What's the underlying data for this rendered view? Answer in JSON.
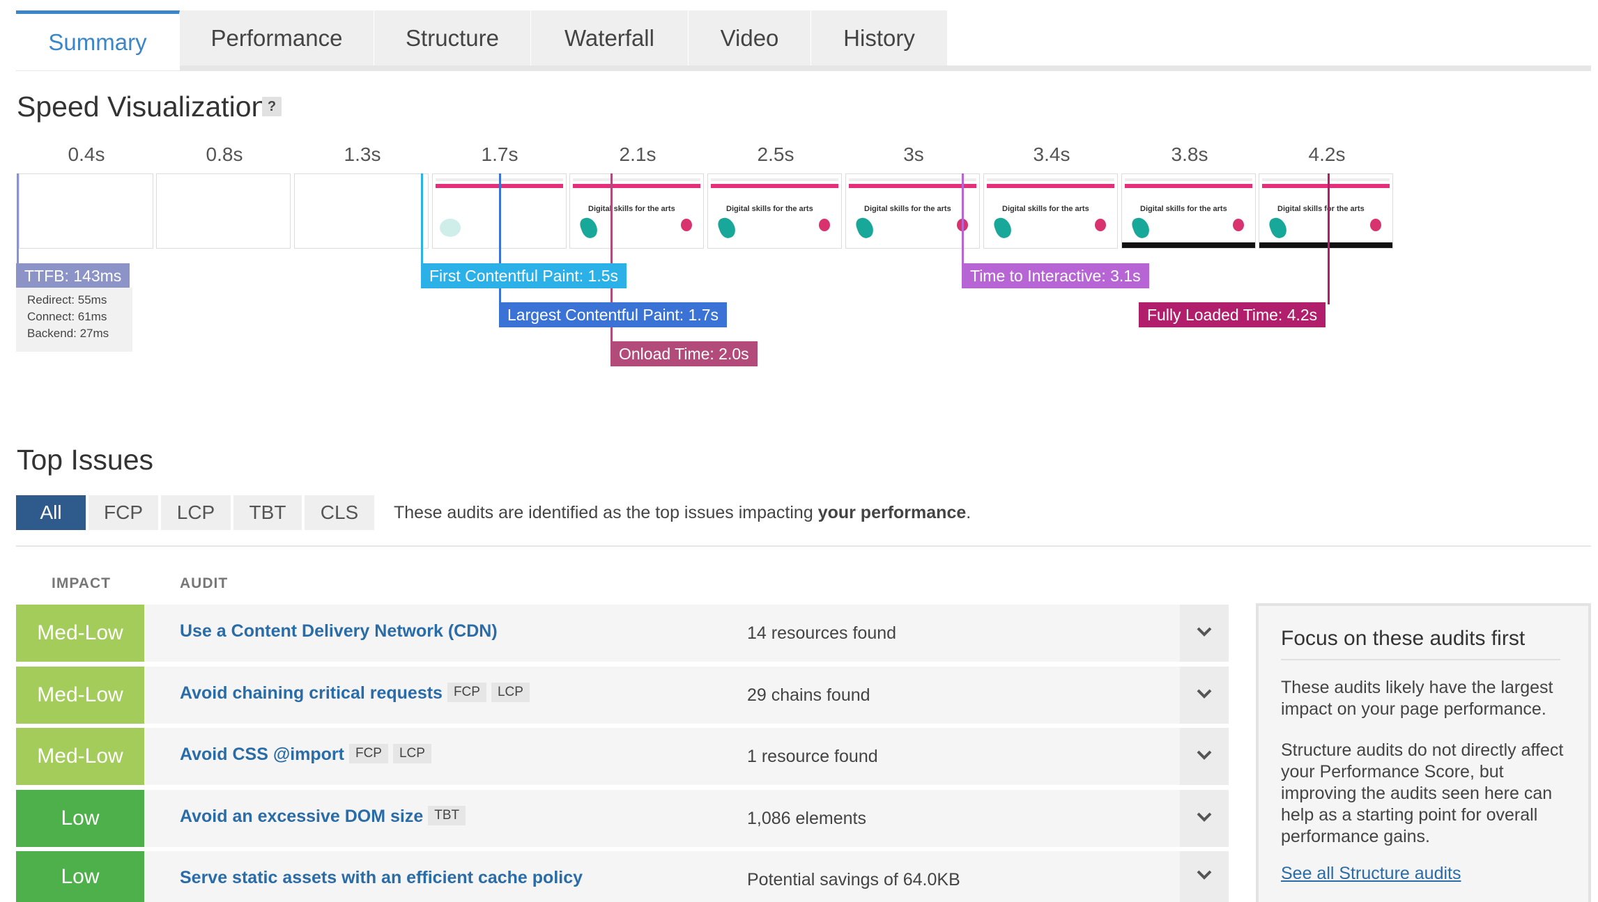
{
  "tabs": [
    {
      "label": "Summary"
    },
    {
      "label": "Performance"
    },
    {
      "label": "Structure"
    },
    {
      "label": "Waterfall"
    },
    {
      "label": "Video"
    },
    {
      "label": "History"
    }
  ],
  "active_tab": "Summary",
  "speed_visualization": {
    "title": "Speed Visualization",
    "help_label": "?",
    "time_labels": [
      "0.4s",
      "0.8s",
      "1.3s",
      "1.7s",
      "2.1s",
      "2.5s",
      "3s",
      "3.4s",
      "3.8s",
      "4.2s"
    ],
    "frame_caption": "Digital skills for the arts",
    "markers": {
      "ttfb": {
        "label": "TTFB: 143ms",
        "color": "#8c93c6"
      },
      "fcp": {
        "label": "First Contentful Paint: 1.5s",
        "color": "#2bb0e8"
      },
      "lcp": {
        "label": "Largest Contentful Paint: 1.7s",
        "color": "#3a72d6"
      },
      "onload": {
        "label": "Onload Time: 2.0s",
        "color": "#b24a7a"
      },
      "tti": {
        "label": "Time to Interactive: 3.1s",
        "color": "#b765d5"
      },
      "fully_loaded": {
        "label": "Fully Loaded Time: 4.2s",
        "color": "#b11f6c"
      }
    },
    "ttfb_details": [
      "Redirect: 55ms",
      "Connect: 61ms",
      "Backend: 27ms"
    ]
  },
  "top_issues": {
    "title": "Top Issues",
    "filters": [
      "All",
      "FCP",
      "LCP",
      "TBT",
      "CLS"
    ],
    "active_filter": "All",
    "description_prefix": "These audits are identified as the top issues impacting ",
    "description_bold": "your performance",
    "description_suffix": ".",
    "columns": {
      "impact": "IMPACT",
      "audit": "AUDIT"
    },
    "rows": [
      {
        "impact": "Med-Low",
        "impact_color": "#a3cc5b",
        "title": "Use a Content Delivery Network (CDN)",
        "tags": [],
        "result": "14 resources found"
      },
      {
        "impact": "Med-Low",
        "impact_color": "#a3cc5b",
        "title": "Avoid chaining critical requests",
        "tags": [
          "FCP",
          "LCP"
        ],
        "result": "29 chains found"
      },
      {
        "impact": "Med-Low",
        "impact_color": "#a3cc5b",
        "title": "Avoid CSS @import",
        "tags": [
          "FCP",
          "LCP"
        ],
        "result": "1 resource found"
      },
      {
        "impact": "Low",
        "impact_color": "#4db04a",
        "title": "Avoid an excessive DOM size",
        "tags": [
          "TBT"
        ],
        "result": "1,086 elements"
      },
      {
        "impact": "Low",
        "impact_color": "#4db04a",
        "title": "Serve static assets with an efficient cache policy",
        "tags": [],
        "result": "Potential savings of 64.0KB"
      }
    ]
  },
  "focus_box": {
    "title": "Focus on these audits first",
    "paragraph1": "These audits likely have the largest impact on your page performance.",
    "paragraph2": "Structure audits do not directly affect your Performance Score, but improving the audits seen here can help as a starting point for overall performance gains.",
    "link": "See all Structure audits"
  }
}
